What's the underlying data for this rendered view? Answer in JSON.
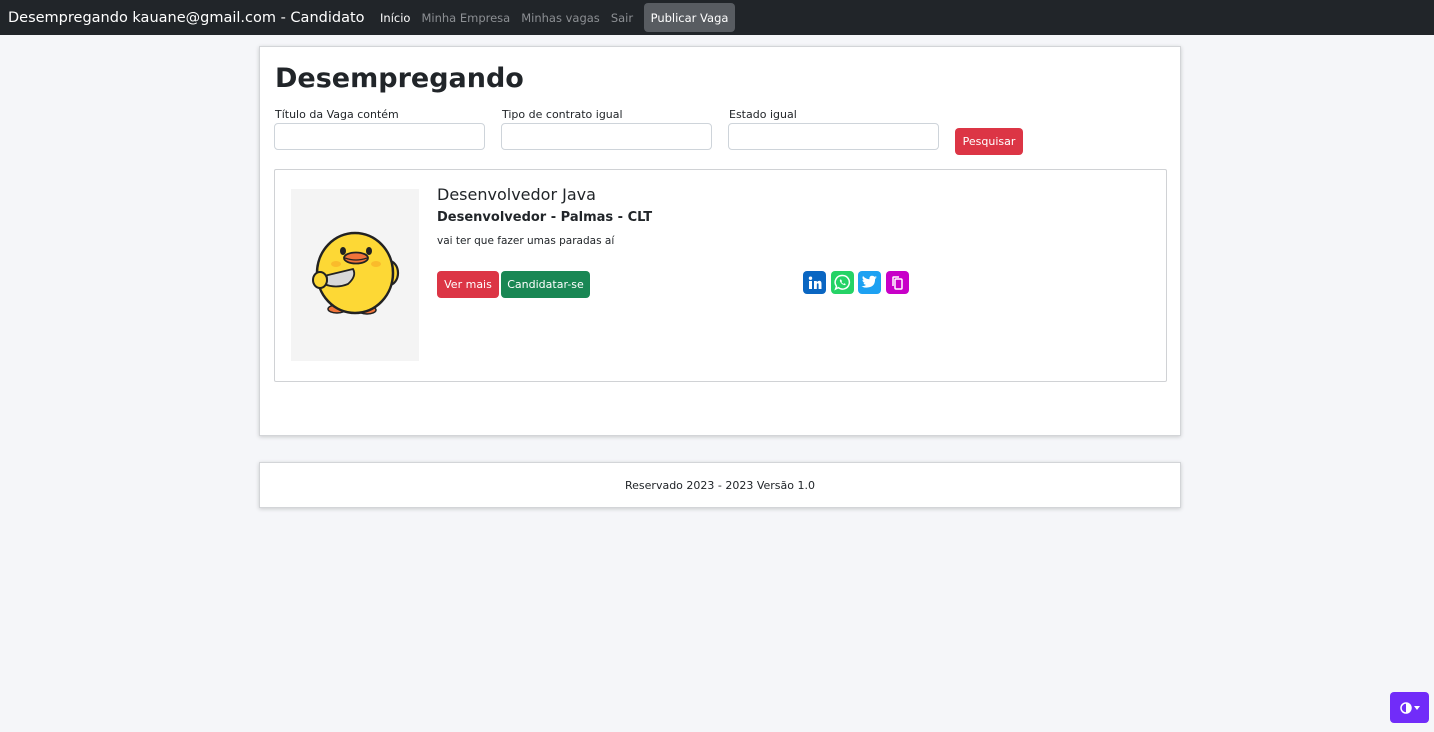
{
  "navbar": {
    "brand": "Desempregando kauane@gmail.com - Candidato",
    "links": [
      {
        "label": "Início",
        "active": true
      },
      {
        "label": "Minha Empresa",
        "active": false
      },
      {
        "label": "Minhas vagas",
        "active": false
      },
      {
        "label": "Sair",
        "active": false
      }
    ],
    "publish_label": "Publicar Vaga"
  },
  "main": {
    "title": "Desempregando",
    "filters": [
      {
        "label": "Título da Vaga contém",
        "value": ""
      },
      {
        "label": "Tipo de contrato igual",
        "value": ""
      },
      {
        "label": "Estado igual",
        "value": ""
      }
    ],
    "search_label": "Pesquisar"
  },
  "job": {
    "title": "Desenvolvedor Java",
    "subtitle": "Desenvolvedor - Palmas - CLT",
    "description": "vai ter que fazer umas paradas aí",
    "more_label": "Ver mais",
    "apply_label": "Candidatar-se",
    "share_icons": [
      {
        "name": "linkedin-icon",
        "color": "#0a66c2"
      },
      {
        "name": "whatsapp-icon",
        "color": "#25d366"
      },
      {
        "name": "twitter-icon",
        "color": "#1da1f2"
      },
      {
        "name": "copy-icon",
        "color": "#c800c8"
      }
    ]
  },
  "footer": {
    "text": "Reservado 2023 - 2023 Versão 1.0"
  },
  "theme_toggle": {
    "icon": "contrast-icon",
    "color": "#712cf9"
  }
}
